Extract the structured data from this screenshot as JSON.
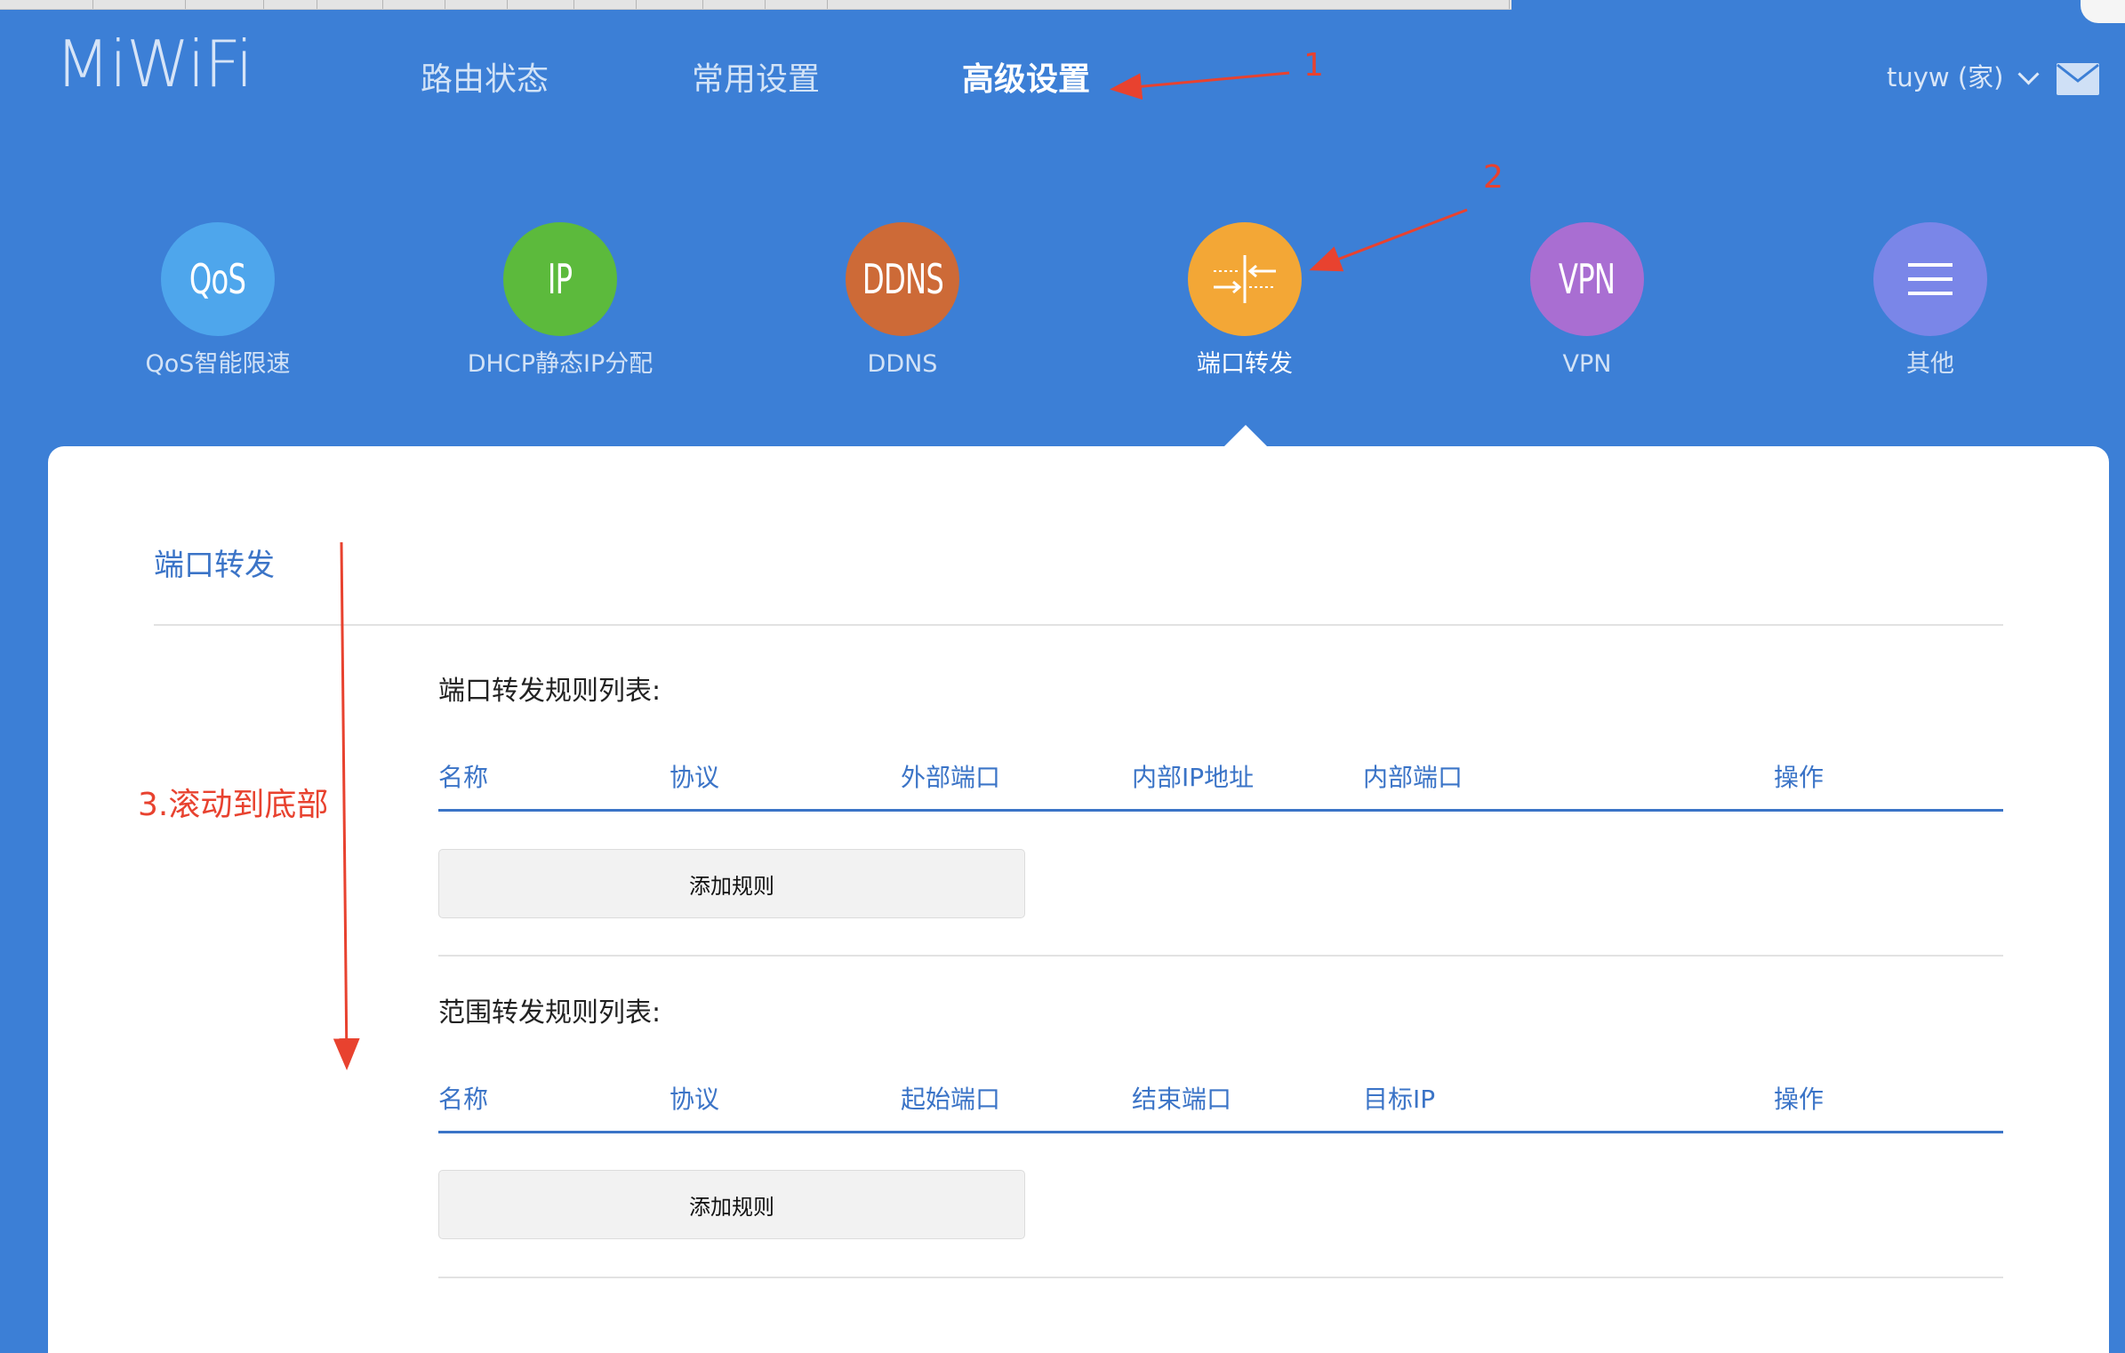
{
  "header": {
    "logo": "MiWiFi",
    "nav": [
      {
        "label": "路由状态",
        "active": false
      },
      {
        "label": "常用设置",
        "active": false
      },
      {
        "label": "高级设置",
        "active": true
      }
    ],
    "user": "tuyw (家)",
    "user_icon": "chevron-down-icon",
    "mail_icon": "mail-icon"
  },
  "features": [
    {
      "label": "QoS智能限速",
      "icon_text": "QoS",
      "color": "#4ea6ec"
    },
    {
      "label": "DHCP静态IP分配",
      "icon_text": "IP",
      "color": "#5cba3c"
    },
    {
      "label": "DDNS",
      "icon_text": "DDNS",
      "color": "#cd6a37"
    },
    {
      "label": "端口转发",
      "icon_text": "",
      "icon": "port-forward-icon",
      "color": "#f3a736",
      "active": true
    },
    {
      "label": "VPN",
      "icon_text": "VPN",
      "color": "#a96ed2"
    },
    {
      "label": "其他",
      "icon_text": "",
      "icon": "menu-icon",
      "color": "#7a86e8"
    }
  ],
  "main": {
    "title": "端口转发",
    "port_forward": {
      "title": "端口转发规则列表:",
      "columns": [
        "名称",
        "协议",
        "外部端口",
        "内部IP地址",
        "内部端口",
        "操作"
      ],
      "add_label": "添加规则"
    },
    "range_forward": {
      "title": "范围转发规则列表:",
      "columns": [
        "名称",
        "协议",
        "起始端口",
        "结束端口",
        "目标IP",
        "操作"
      ],
      "add_label": "添加规则"
    }
  },
  "annotations": {
    "a1": "1",
    "a2": "2",
    "a3": "3.滚动到底部",
    "color": "#e8422f"
  }
}
